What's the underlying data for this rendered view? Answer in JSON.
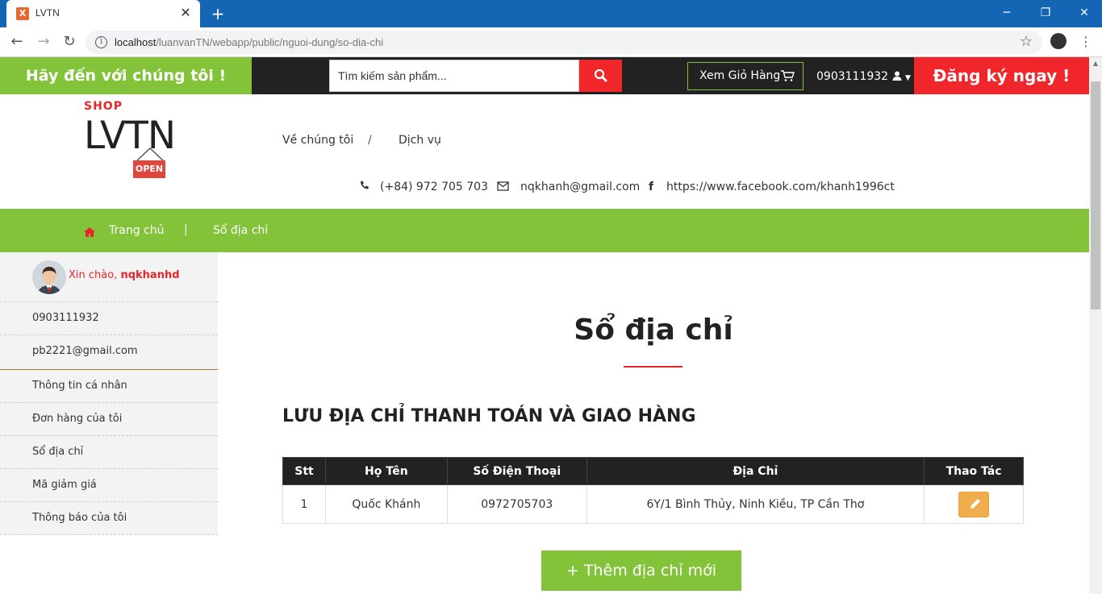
{
  "browser": {
    "tab_title": "LVTN",
    "tab_favicon": "X",
    "url_host": "localhost",
    "url_path": "/luanvanTN/webapp/public/nguoi-dung/so-dia-chi"
  },
  "topbar": {
    "promo": "Hãy đến với chúng tôi !",
    "search_placeholder": "Tìm kiếm sản phẩm...",
    "cart_label": "Xem Giỏ Hàng",
    "user_phone": "0903111932",
    "register_label": "Đăng ký ngay !"
  },
  "header": {
    "logo_shop": "SHOP",
    "logo_name": "LVTN",
    "logo_sign": "OPEN",
    "nav": [
      "Về chúng tôi",
      "/",
      "Dịch vụ"
    ],
    "phone": "(+84) 972 705 703",
    "email": "nqkhanh@gmail.com",
    "facebook": "https://www.facebook.com/khanh1996ct"
  },
  "breadcrumb": {
    "home": "Trang chủ",
    "separator": "|",
    "current": "Sổ địa chỉ"
  },
  "sidebar": {
    "greeting": "Xin chào,",
    "username": "nqkhanhd",
    "phone": "0903111932",
    "email": "pb2221@gmail.com",
    "menu": [
      "Thông tin cá nhân",
      "Đơn hàng của tôi",
      "Sổ địa chỉ",
      "Mã giảm giá",
      "Thông báo của tôi"
    ]
  },
  "main": {
    "title": "Sổ địa chỉ",
    "subheading": "LƯU ĐỊA CHỈ THANH TOÁN VÀ GIAO HÀNG",
    "table": {
      "headers": [
        "Stt",
        "Họ Tên",
        "Số Điện Thoại",
        "Địa Chỉ",
        "Thao Tác"
      ],
      "rows": [
        {
          "stt": "1",
          "name": "Quốc Khánh",
          "phone": "0972705703",
          "address": "6Y/1 Bình Thủy, Ninh Kiều, TP Cần Thơ"
        }
      ]
    },
    "add_button": "+ Thêm địa chỉ mới"
  },
  "colors": {
    "brand_green": "#83c33a",
    "brand_red": "#f0262a",
    "dark": "#222222",
    "edit_orange": "#f0ad4e"
  }
}
